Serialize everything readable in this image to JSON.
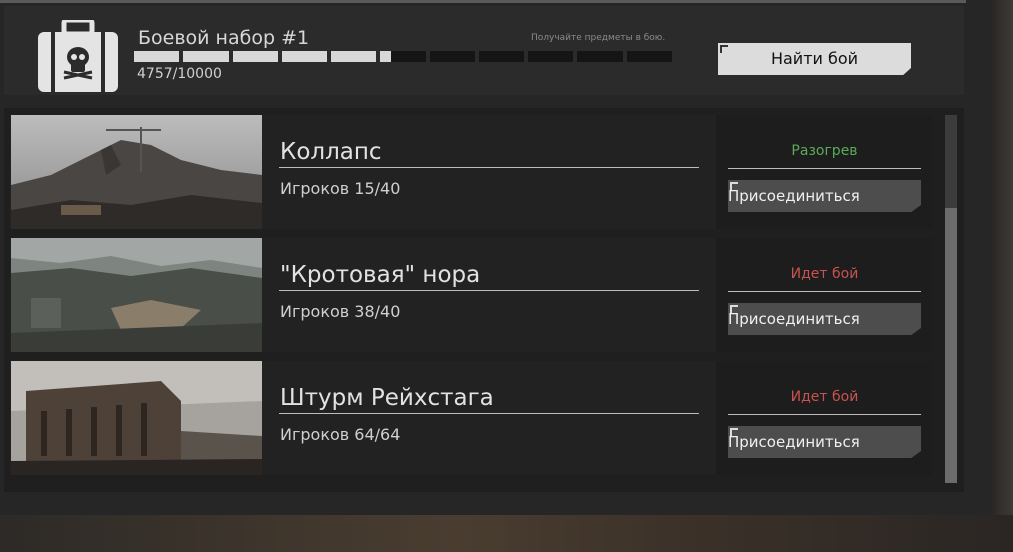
{
  "kit": {
    "title": "Боевой набор #1",
    "hint": "Получайте предметы в бою.",
    "progress_current": 4757,
    "progress_max": 10000,
    "progress_label": "4757/10000",
    "icon": "briefcase-skull-icon"
  },
  "find_battle_label": "Найти бой",
  "matches": [
    {
      "name": "Коллапс",
      "players": "Игроков 15/40",
      "status": "Разогрев",
      "status_color": "#5aaa5a",
      "join_label": "Присоединиться"
    },
    {
      "name": "\"Кротовая\" нора",
      "players": "Игроков 38/40",
      "status": "Идет бой",
      "status_color": "#c8534f",
      "join_label": "Присоединиться"
    },
    {
      "name": "Штурм Рейхстага",
      "players": "Игроков 64/64",
      "status": "Идет бой",
      "status_color": "#c8534f",
      "join_label": "Присоединиться"
    }
  ],
  "colors": {
    "panel": "#262626",
    "button_light": "#dcdcdc",
    "button_dark": "#4d4d4d"
  }
}
